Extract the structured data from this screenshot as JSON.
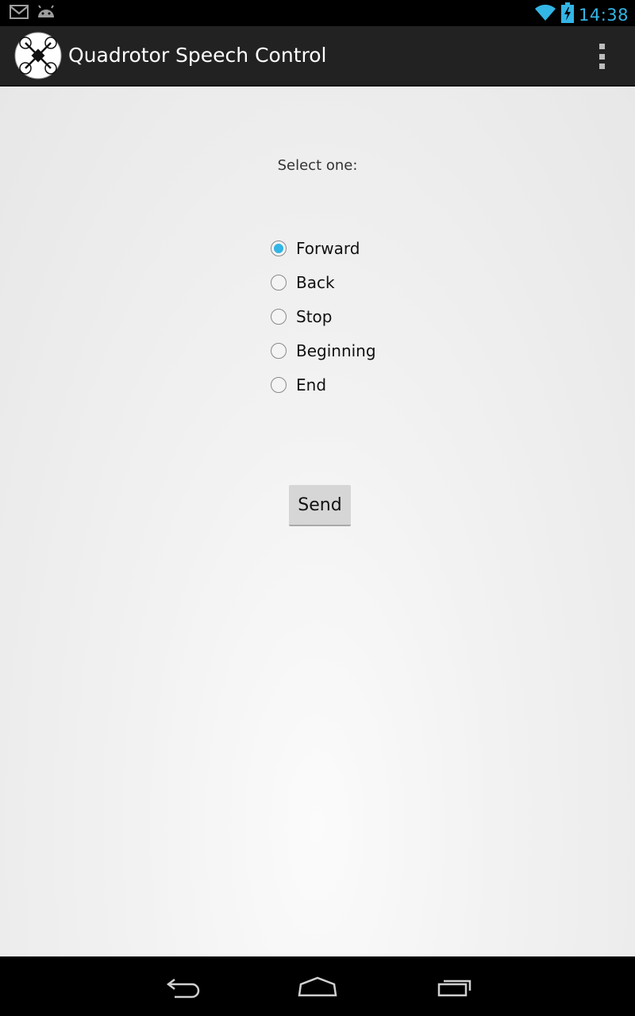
{
  "status_bar": {
    "time": "14:38",
    "notification_icons": [
      "gmail-icon",
      "android-icon"
    ],
    "system_icons": [
      "wifi-icon",
      "battery-charging-icon"
    ],
    "accent_color": "#33b5e5"
  },
  "action_bar": {
    "title": "Quadrotor Speech Control",
    "logo_icon": "quadrotor-logo-icon",
    "overflow_icon": "overflow-menu-icon"
  },
  "main": {
    "prompt": "Select one:",
    "options": [
      {
        "label": "Forward",
        "checked": true
      },
      {
        "label": "Back",
        "checked": false
      },
      {
        "label": "Stop",
        "checked": false
      },
      {
        "label": "Beginning",
        "checked": false
      },
      {
        "label": "End",
        "checked": false
      }
    ],
    "send_label": "Send"
  },
  "nav_bar": {
    "buttons": [
      "back-icon",
      "home-icon",
      "recent-apps-icon"
    ]
  }
}
